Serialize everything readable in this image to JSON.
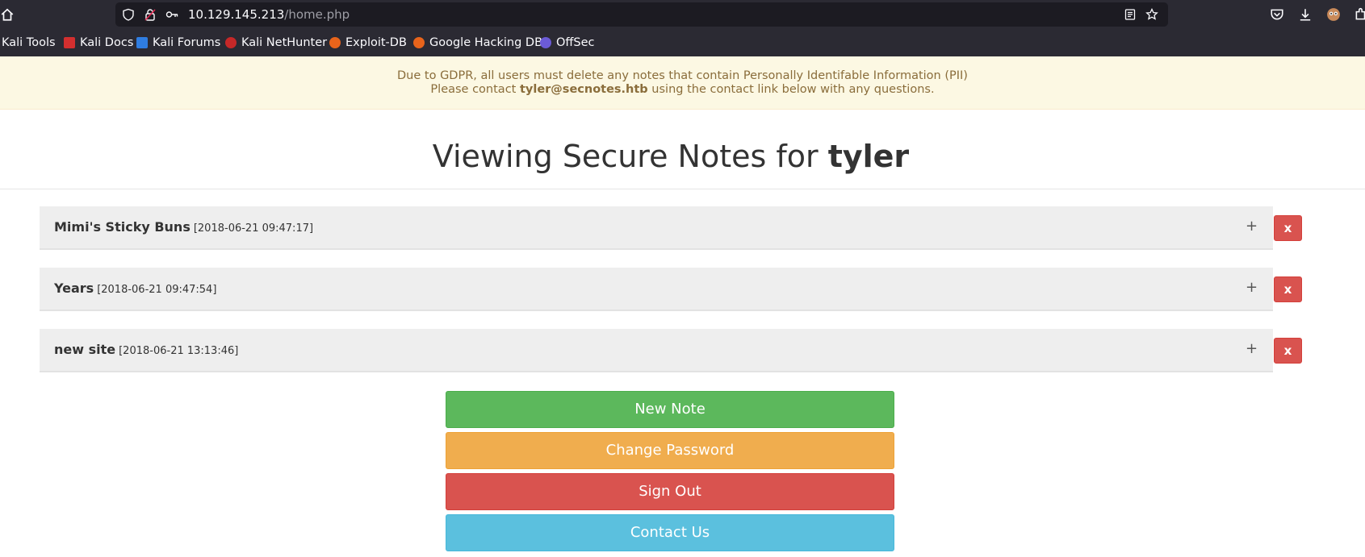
{
  "browser": {
    "url_host": "10.129.145.213",
    "url_path": "/home.php",
    "bookmarks": [
      {
        "label": "Kali Tools",
        "icon": "kali-icon"
      },
      {
        "label": "Kali Docs",
        "icon": "kali-docs-icon"
      },
      {
        "label": "Kali Forums",
        "icon": "kali-forums-icon"
      },
      {
        "label": "Kali NetHunter",
        "icon": "nethunter-icon"
      },
      {
        "label": "Exploit-DB",
        "icon": "exploit-db-icon"
      },
      {
        "label": "Google Hacking DB",
        "icon": "ghdb-icon"
      },
      {
        "label": "OffSec",
        "icon": "offsec-icon"
      }
    ]
  },
  "notice": {
    "line1": "Due to GDPR, all users must delete any notes that contain Personally Identifable Information (PII)",
    "line2_prefix": "Please contact ",
    "line2_email": "tyler@secnotes.htb",
    "line2_suffix": " using the contact link below with any questions."
  },
  "heading": {
    "prefix": "Viewing Secure Notes for ",
    "username": "tyler"
  },
  "notes": [
    {
      "title": "Mimi's Sticky Buns",
      "timestamp": "[2018-06-21 09:47:17]",
      "expand": "+",
      "delete": "x"
    },
    {
      "title": "Years",
      "timestamp": "[2018-06-21 09:47:54]",
      "expand": "+",
      "delete": "x"
    },
    {
      "title": "new site",
      "timestamp": "[2018-06-21 13:13:46]",
      "expand": "+",
      "delete": "x"
    }
  ],
  "actions": {
    "new_note": "New Note",
    "change_password": "Change Password",
    "sign_out": "Sign Out",
    "contact_us": "Contact Us"
  },
  "colors": {
    "notice_bg": "#fcf8e3",
    "success": "#5cb85c",
    "warning": "#f0ad4e",
    "danger": "#d9534f",
    "info": "#5bc0de"
  }
}
